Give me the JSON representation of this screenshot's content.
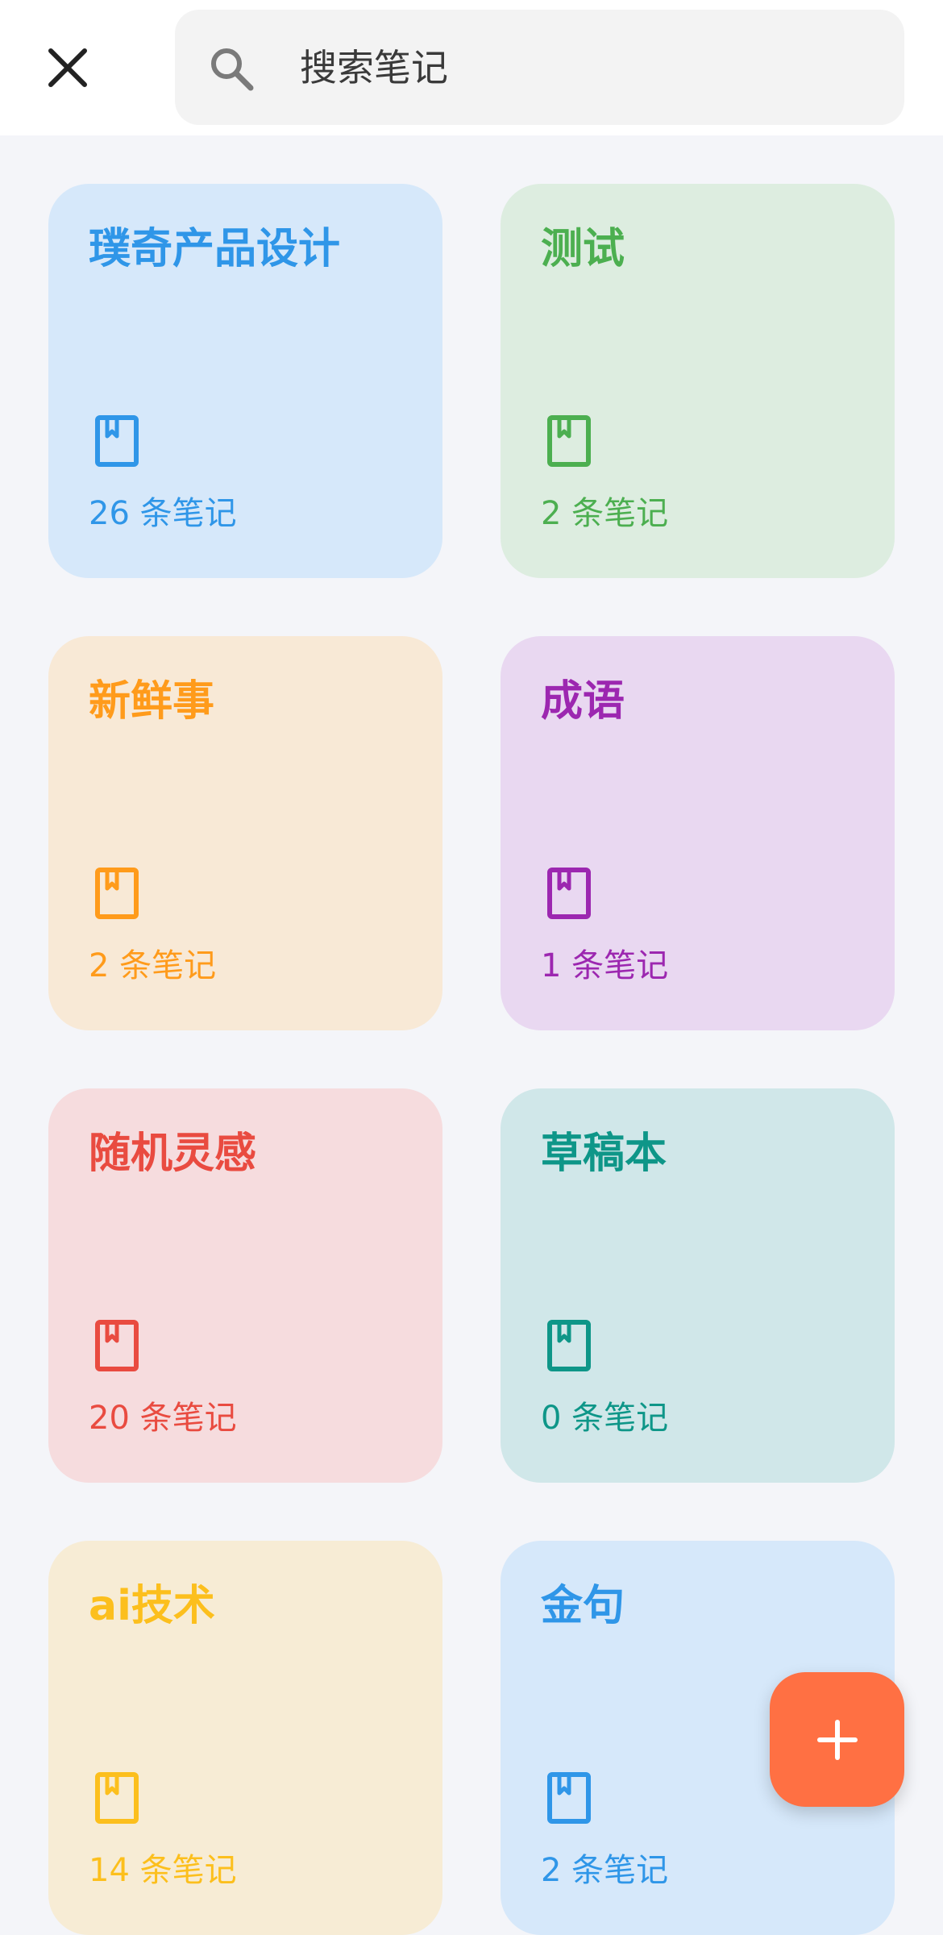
{
  "search": {
    "placeholder": "搜索笔记",
    "value": ""
  },
  "icons": {
    "close": "close-icon",
    "search": "search-icon",
    "notebook": "notebook-icon",
    "add": "plus-icon"
  },
  "colors": {
    "fab": "#ff7043"
  },
  "notebooks": [
    {
      "title": "璞奇产品设计",
      "count": "26 条笔记",
      "color": "#2f96e8",
      "bg": "#d6e8fa"
    },
    {
      "title": "测试",
      "count": "2 条笔记",
      "color": "#4caf50",
      "bg": "#ddede0"
    },
    {
      "title": "新鲜事",
      "count": "2 条笔记",
      "color": "#ff9b1b",
      "bg": "#f8e9d6"
    },
    {
      "title": "成语",
      "count": "1 条笔记",
      "color": "#9c27b0",
      "bg": "#e9d8f1"
    },
    {
      "title": "随机灵感",
      "count": "20 条笔记",
      "color": "#e94b40",
      "bg": "#f6dcde"
    },
    {
      "title": "草稿本",
      "count": "0 条笔记",
      "color": "#0e9688",
      "bg": "#d0e7e9"
    },
    {
      "title": "ai技术",
      "count": "14 条笔记",
      "color": "#fcbf1d",
      "bg": "#f7ecd5"
    },
    {
      "title": "金句",
      "count": "2 条笔记",
      "color": "#2f96e8",
      "bg": "#d6e8fa"
    }
  ]
}
